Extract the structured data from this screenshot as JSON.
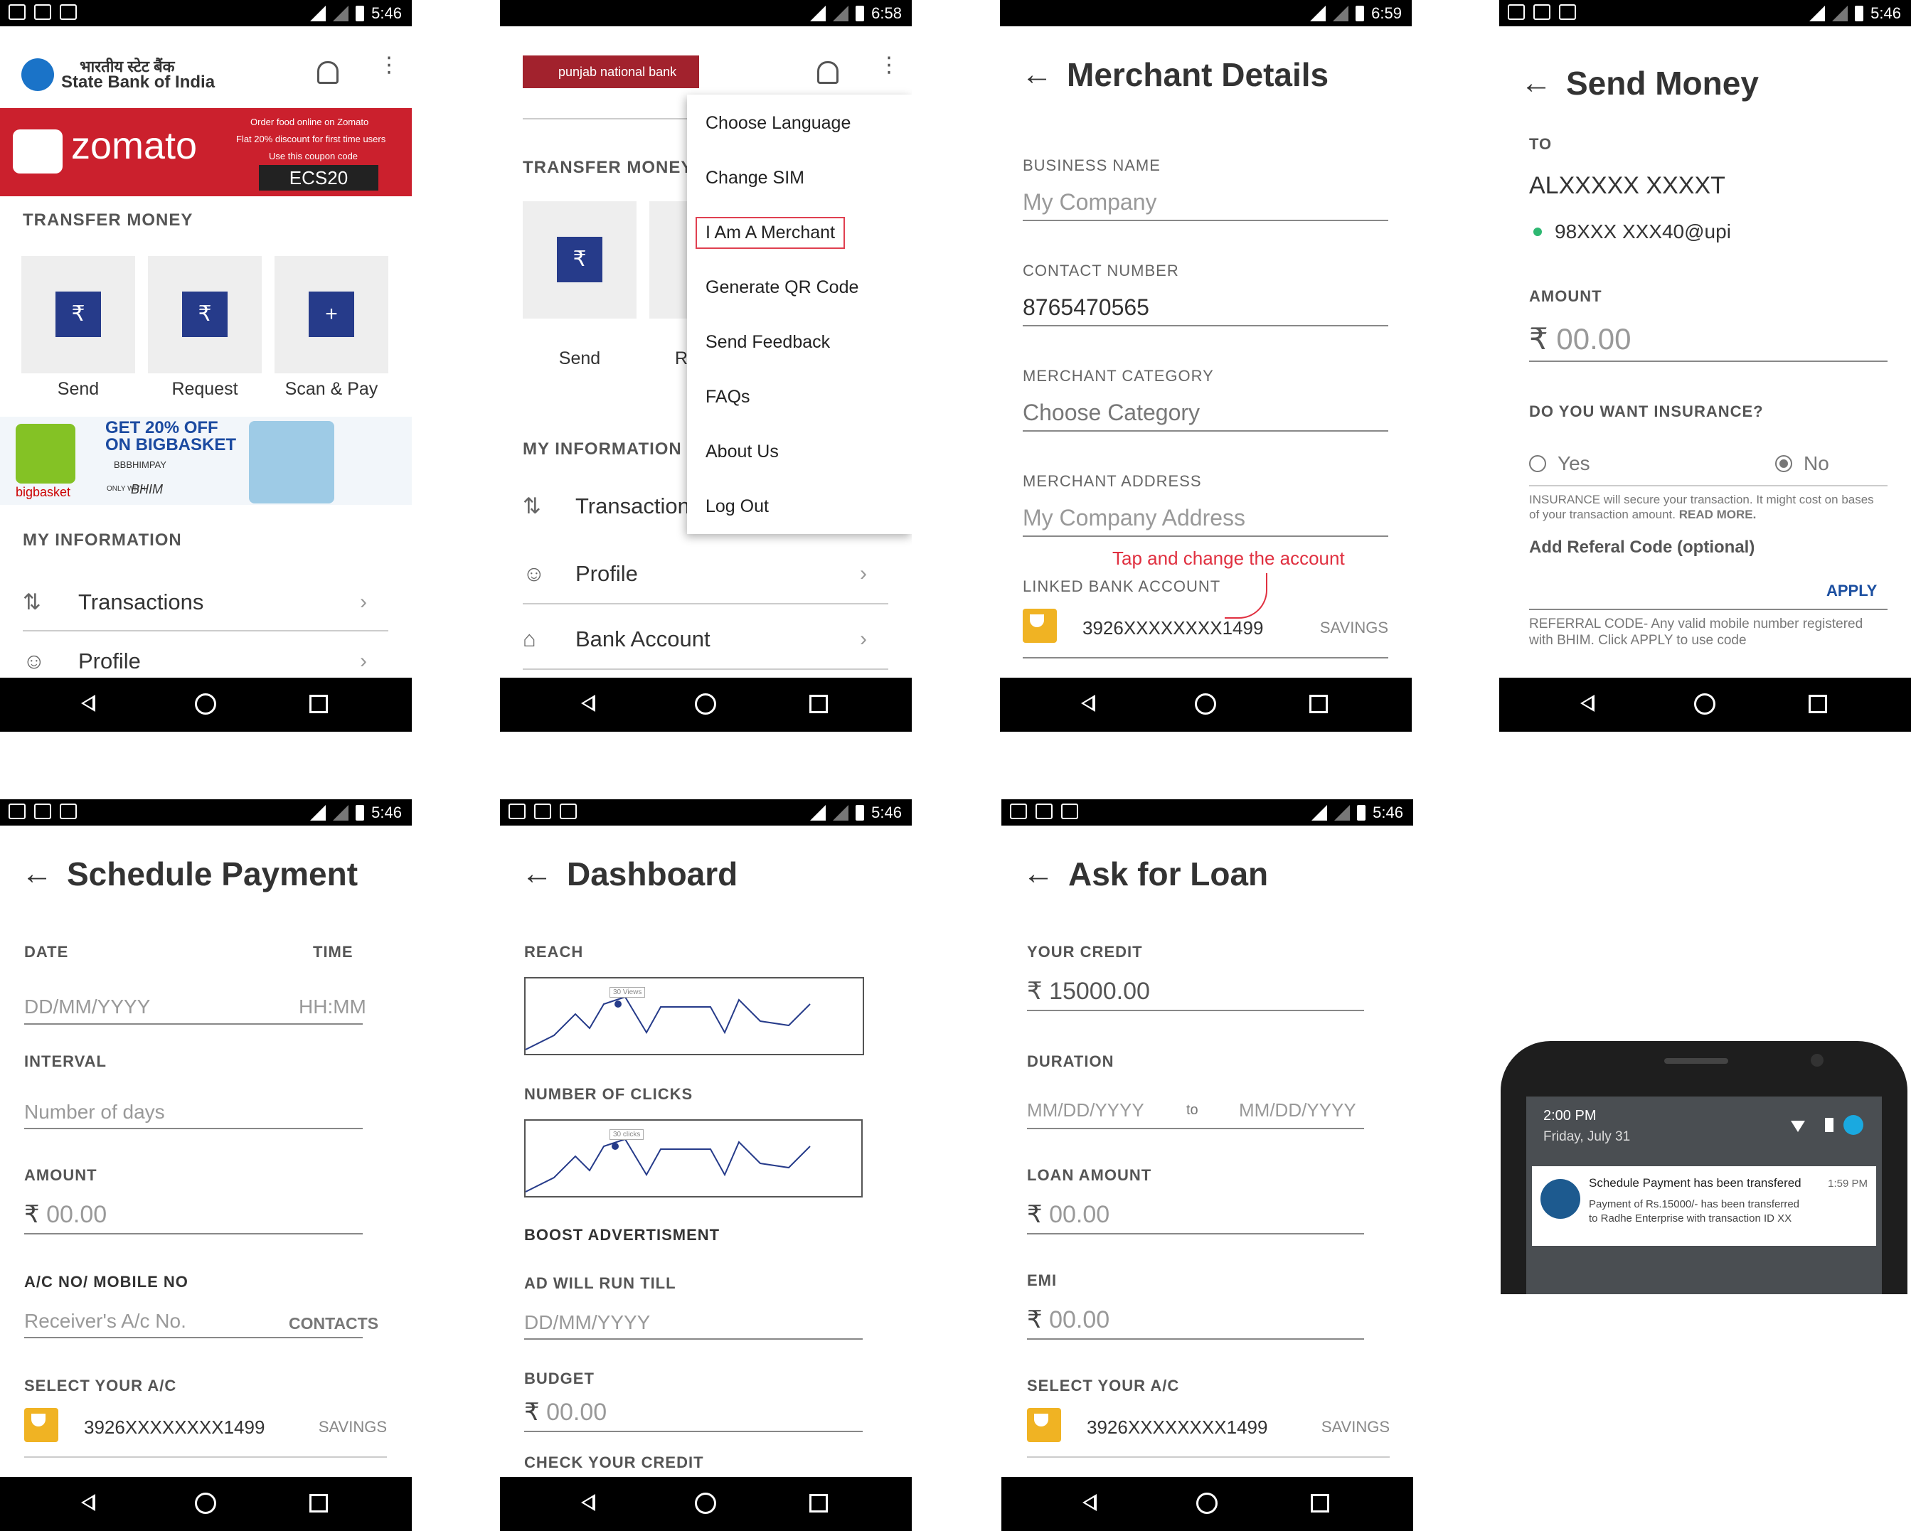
{
  "status": {
    "time_a": "5:46",
    "time_b": "6:58",
    "time_c": "6:59",
    "time_d": "5:46"
  },
  "p1": {
    "logo_hi": "भारतीय स्टेट बैंक",
    "logo_en": "State Bank of India",
    "zomato": "zomato",
    "z_line1": "Order food online on Zomato",
    "z_line2": "Flat 20% discount for first time users",
    "z_line3": "Use this coupon code",
    "z_code": "ECS20",
    "transfer": "TRANSFER MONEY",
    "send": "Send",
    "request": "Request",
    "scan": "Scan & Pay",
    "bb_brand": "bigbasket",
    "bb_offer": "GET 20% OFF ON BIGBASKET",
    "bb_code": "BBBHIMPAY",
    "bb_only": "ONLY WITH",
    "bb_bhim": "BHIM",
    "myinfo": "MY INFORMATION",
    "transactions": "Transactions",
    "profile": "Profile"
  },
  "p2": {
    "logo": "punjab national bank",
    "transfer": "TRANSFER MONEY",
    "send": "Send",
    "req": "Re",
    "myinfo": "MY INFORMATION",
    "transaction": "Transaction",
    "profile": "Profile",
    "bank": "Bank Account",
    "menu": [
      "Choose Language",
      "Change SIM",
      "I Am A Merchant",
      "Generate QR Code",
      "Send Feedback",
      "FAQs",
      "About Us",
      "Log Out"
    ]
  },
  "p3": {
    "title": "Merchant Details",
    "l_name": "BUSINESS NAME",
    "v_name": "My Company",
    "l_contact": "CONTACT NUMBER",
    "v_contact": "8765470565",
    "l_cat": "MERCHANT CATEGORY",
    "v_cat": "Choose Category",
    "l_addr": "MERCHANT ADDRESS",
    "v_addr": "My Company Address",
    "note": "Tap and change the account",
    "l_bank": "LINKED BANK ACCOUNT",
    "acct": "3926XXXXXXXX1499",
    "savings": "SAVINGS"
  },
  "p4": {
    "title": "Send Money",
    "l_to": "TO",
    "name": "ALXXXXX XXXXT",
    "upi": "98XXX XXX40@upi",
    "l_amt": "AMOUNT",
    "amt": "00.00",
    "l_ins": "DO YOU WANT INSURANCE?",
    "yes": "Yes",
    "no": "No",
    "ins_note": "INSURANCE will secure your transaction. It might cost on bases of your transaction amount.",
    "read_more": "READ MORE.",
    "referal": "Add Referal Code (optional)",
    "apply": "APPLY",
    "ref_note": "REFERRAL CODE- Any valid mobile number registered with BHIM. Click APPLY to use code"
  },
  "p5": {
    "title": "Schedule Payment",
    "l_date": "DATE",
    "l_time": "TIME",
    "date": "DD/MM/YYYY",
    "time": "HH:MM",
    "l_int": "INTERVAL",
    "int": "Number of days",
    "l_amt": "AMOUNT",
    "amt": "00.00",
    "l_ac": "A/C NO/ MOBILE NO",
    "ac": "Receiver's A/c No.",
    "contacts": "CONTACTS",
    "l_sel": "SELECT YOUR A/C",
    "acct": "3926XXXXXXXX1499",
    "savings": "SAVINGS"
  },
  "p6": {
    "title": "Dashboard",
    "l_reach": "REACH",
    "reach_tip": "30 Views",
    "l_clicks": "NUMBER OF CLICKS",
    "clicks_tip": "30 clicks",
    "boost": "BOOST ADVERTISMENT",
    "l_till": "AD WILL RUN TILL",
    "till": "DD/MM/YYYY",
    "l_budget": "BUDGET",
    "budget": "00.00",
    "check": "CHECK YOUR CREDIT"
  },
  "p7": {
    "title": "Ask for Loan",
    "l_credit": "YOUR CREDIT",
    "credit": "15000.00",
    "l_dur": "DURATION",
    "from": "MM/DD/YYYY",
    "to": "to",
    "until": "MM/DD/YYYY",
    "l_loan": "LOAN AMOUNT",
    "loan": "00.00",
    "l_emi": "EMI",
    "emi": "00.00",
    "l_sel": "SELECT YOUR A/C",
    "acct": "3926XXXXXXXX1499",
    "savings": "SAVINGS"
  },
  "notif": {
    "time": "2:00 PM",
    "date": "Friday, July 31",
    "title": "Schedule Payment has been transfered",
    "ntime": "1:59 PM",
    "body": "Payment of Rs.15000/- has been transferred to Radhe Enterprise with transaction ID XX"
  }
}
